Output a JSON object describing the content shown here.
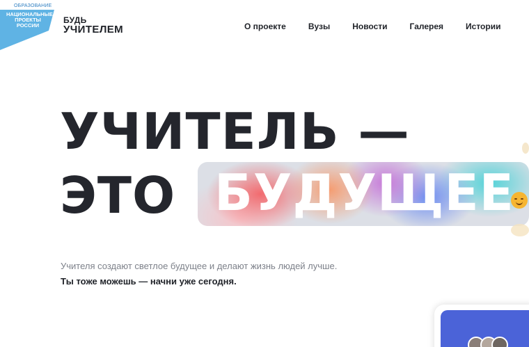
{
  "header": {
    "badge": {
      "top_label": "ОБРАЗОВАНИЕ",
      "main_label_lines": [
        "НАЦИОНАЛЬНЫЕ",
        "ПРОЕКТЫ",
        "РОССИИ"
      ]
    },
    "logo": {
      "line1": "БУДЬ",
      "line2": "УЧИТЕЛЕМ"
    },
    "nav": [
      {
        "label": "О проекте"
      },
      {
        "label": "Вузы"
      },
      {
        "label": "Новости"
      },
      {
        "label": "Галерея"
      },
      {
        "label": "Истории"
      }
    ]
  },
  "hero": {
    "line1": "УЧИТЕЛЬ —",
    "line2_prefix": "ЭТО",
    "highlight_word": "БУДУЩЕЕ",
    "subtitle": "Учителя создают светлое будущее и делают жизнь людей лучше.",
    "subtitle_bold": "Ты тоже можешь — начни уже сегодня."
  },
  "colors": {
    "text_dark": "#24262d",
    "text_muted": "#7d818a",
    "badge_blue": "#5fb3e4",
    "card_blue": "#4b63d8"
  },
  "icons": [
    "national-projects-badge-icon",
    "smiling-face-emoji-icon"
  ]
}
